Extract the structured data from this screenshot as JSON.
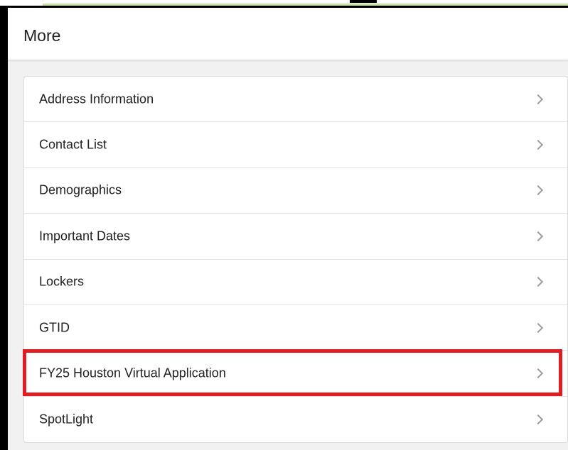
{
  "header": {
    "title": "More"
  },
  "menu": {
    "items": [
      {
        "label": "Address Information",
        "icon": "chevron-right-icon"
      },
      {
        "label": "Contact List",
        "icon": "chevron-right-icon"
      },
      {
        "label": "Demographics",
        "icon": "chevron-right-icon"
      },
      {
        "label": "Important Dates",
        "icon": "chevron-right-icon"
      },
      {
        "label": "Lockers",
        "icon": "chevron-right-icon"
      },
      {
        "label": "GTID",
        "icon": "chevron-right-icon"
      },
      {
        "label": "FY25 Houston Virtual Application",
        "icon": "chevron-right-icon",
        "highlighted": true
      },
      {
        "label": "SpotLight",
        "icon": "chevron-right-icon"
      }
    ]
  },
  "colors": {
    "highlight": "#e21c23",
    "background": "#f1f1f1",
    "card": "#ffffff",
    "frame": "#000000"
  }
}
